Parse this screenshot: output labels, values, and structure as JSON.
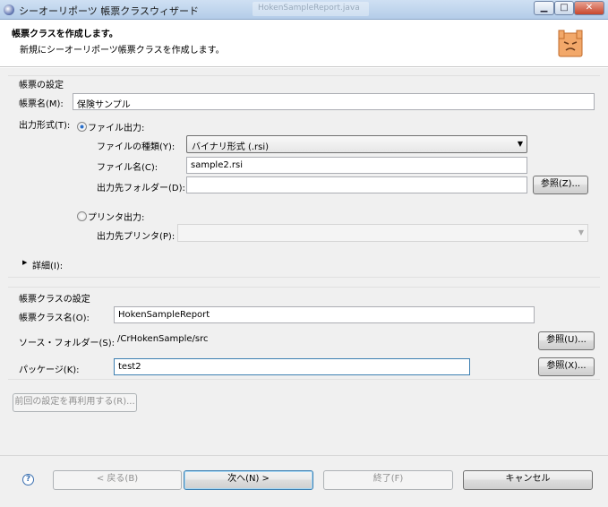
{
  "window": {
    "title": "シーオーリポーツ 帳票クラスウィザード",
    "bg_tab": "HokenSampleReport.java"
  },
  "header": {
    "title": "帳票クラスを作成します。",
    "description": "新規にシーオーリポーツ帳票クラスを作成します。"
  },
  "report": {
    "section_label": "帳票の設定",
    "name_label": "帳票名(M):",
    "name_value": "保険サンプル",
    "format_label": "出力形式(T):",
    "file_output_label": "ファイル出力:",
    "file_type_label": "ファイルの種類(Y):",
    "file_type_value": "バイナリ形式 (.rsi)",
    "file_name_label": "ファイル名(C):",
    "file_name_value": "sample2.rsi",
    "dest_folder_label": "出力先フォルダー(D):",
    "dest_folder_value": "",
    "browse1": "参照(Z)...",
    "printer_output_label": "プリンタ出力:",
    "dest_printer_label": "出力先プリンタ(P):",
    "dest_printer_value": "",
    "details_label": "詳細(I):"
  },
  "class_settings": {
    "section_label": "帳票クラスの設定",
    "class_name_label": "帳票クラス名(O):",
    "class_name_value": "HokenSampleReport",
    "source_folder_label": "ソース・フォルダー(S):",
    "source_folder_value": "/CrHokenSample/src",
    "browse_source": "参照(U)...",
    "package_label": "パッケージ(K):",
    "package_value": "test2",
    "browse_package": "参照(X)..."
  },
  "reuse_button": "前回の設定を再利用する(R)...",
  "footer": {
    "help": "?",
    "back": "< 戻る(B)",
    "next": "次へ(N) >",
    "finish": "終了(F)",
    "cancel": "キャンセル"
  },
  "window_controls": {
    "minimize": "▁",
    "maximize": "□",
    "close": "✕"
  },
  "icons": {
    "app": "eclipse-icon",
    "help": "help-icon",
    "logo": "report-wizard-logo"
  }
}
